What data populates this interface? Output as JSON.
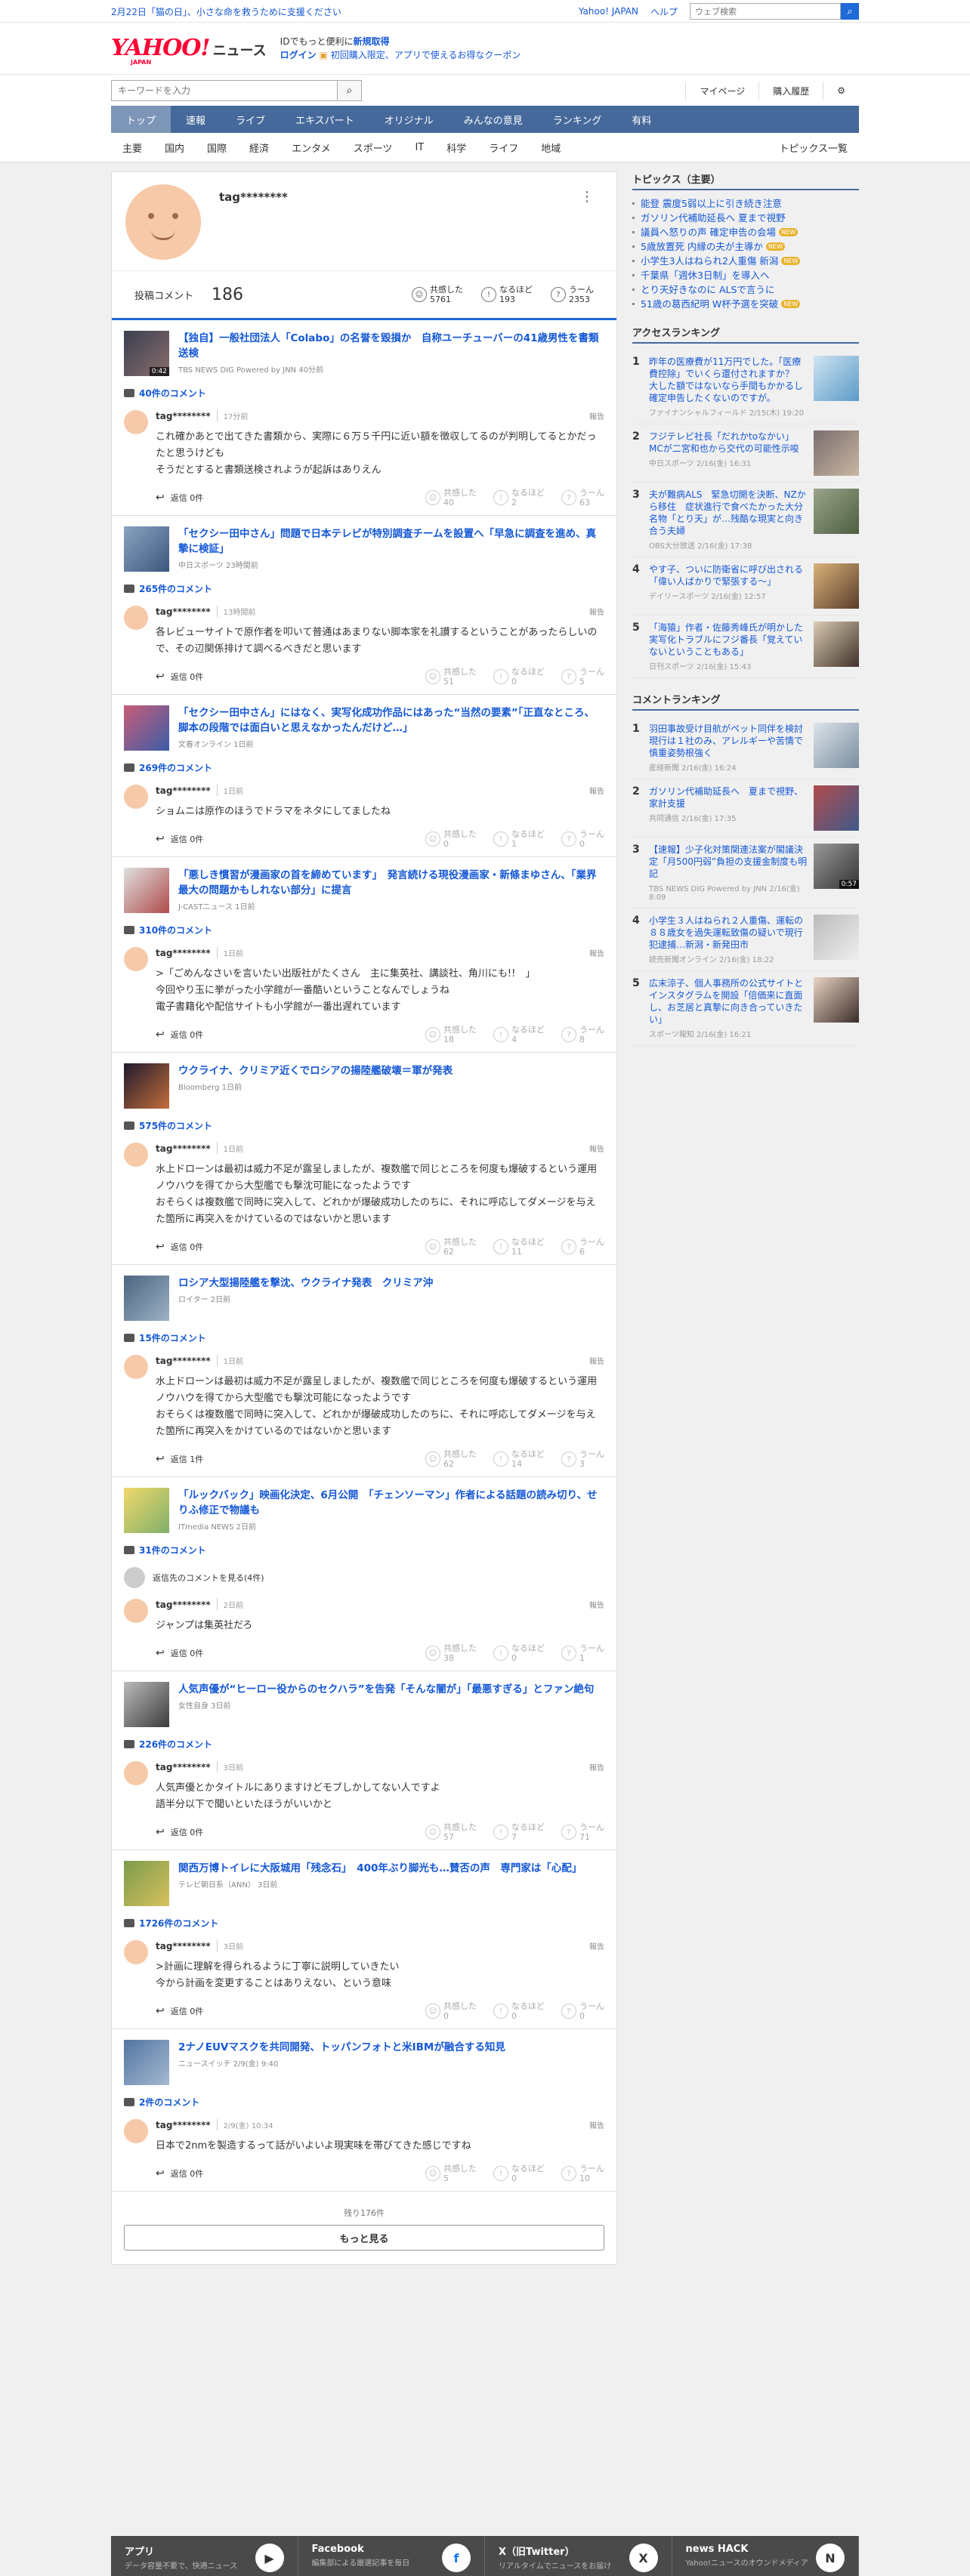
{
  "topbar": {
    "date_text": "2月22日「猫の日」、小さな命を救うために支援ください",
    "yahoo_japan": "Yahoo! JAPAN",
    "help": "ヘルプ",
    "web_search_placeholder": "ウェブ検索"
  },
  "header": {
    "logo": "YAHOO!",
    "logo_sub": "JAPAN",
    "news": "ニュース",
    "promo_line1_pre": "IDでもっと便利に",
    "promo_line1_link": "新規取得",
    "promo_line2_login": "ログイン",
    "promo_line2_text": "初回購入限定、アプリで使えるお得なクーポン"
  },
  "search": {
    "placeholder": "キーワードを入力",
    "mypage": "マイページ",
    "history": "購入履歴"
  },
  "nav": [
    "トップ",
    "速報",
    "ライブ",
    "エキスパート",
    "オリジナル",
    "みんなの意見",
    "ランキング",
    "有料"
  ],
  "subnav": [
    "主要",
    "国内",
    "国際",
    "経済",
    "エンタメ",
    "スポーツ",
    "IT",
    "科学",
    "ライフ",
    "地域"
  ],
  "subnav_all": "トピックス一覧",
  "profile": {
    "username": "tag********",
    "posts_label": "投稿コメント",
    "posts_count": "186",
    "empathy_label": "共感した",
    "empathy_count": "5761",
    "nruhodo_label": "なるほど",
    "nruhodo_count": "193",
    "uun_label": "うーん",
    "uun_count": "2353"
  },
  "articles": [
    {
      "title": "【独自】一般社団法人「Colabo」の名誉を毀損か　自称ユーチューバーの41歳男性を書類送検",
      "src": "TBS NEWS DIG Powered by JNN 40分前",
      "dur": "0:42",
      "ccount": "40件のコメント",
      "comments": [
        {
          "user": "tag********",
          "time": "17分前",
          "text": "これ確かあとで出てきた書類から、実際に６万５千円に近い額を徴収してるのが判明してるとかだったと思うけども\nそうだとすると書類送検されようが起訴はありえん",
          "reply": "返信 0件",
          "e": "40",
          "n": "2",
          "u": "63"
        }
      ]
    },
    {
      "title": "「セクシー田中さん」問題で日本テレビが特別調査チームを設置へ「早急に調査を進め、真摯に検証」",
      "src": "中日スポーツ 23時間前",
      "ccount": "265件のコメント",
      "comments": [
        {
          "user": "tag********",
          "time": "13時間前",
          "text": "各レビューサイトで原作者を叩いて普通はあまりない脚本家を礼讃するということがあったらしいので、その辺関係排けて調べるべきだと思います",
          "reply": "返信 0件",
          "e": "51",
          "n": "0",
          "u": "5"
        }
      ]
    },
    {
      "title": "「セクシー田中さん」にはなく、実写化成功作品にはあった“当然の要素”「正直なところ、脚本の段階では面白いと思えなかったんだけど…」",
      "src": "文春オンライン 1日前",
      "ccount": "269件のコメント",
      "comments": [
        {
          "user": "tag********",
          "time": "1日前",
          "text": "ショムニは原作のほうでドラマをネタにしてましたね",
          "reply": "返信 0件",
          "e": "0",
          "n": "1",
          "u": "0"
        }
      ]
    },
    {
      "title": "「悪しき慣習が漫画家の首を締めています」　発言続ける現役漫画家・新條まゆさん、「業界最大の問題かもしれない部分」に提言",
      "src": "J-CASTニュース 1日前",
      "ccount": "310件のコメント",
      "comments": [
        {
          "user": "tag********",
          "time": "1日前",
          "text": ">「ごめんなさいを言いたい出版社がたくさん　主に集英社、講談社、角川にも!!　」\n今回やり玉に挙がった小学館が一番酷いということなんでしょうね\n電子書籍化や配信サイトも小学館が一番出遅れています",
          "reply": "返信 0件",
          "e": "18",
          "n": "4",
          "u": "8"
        }
      ]
    },
    {
      "title": "ウクライナ、クリミア近くでロシアの揚陸艦破壊＝軍が発表",
      "src": "Bloomberg 1日前",
      "ccount": "575件のコメント",
      "comments": [
        {
          "user": "tag********",
          "time": "1日前",
          "text": "水上ドローンは最初は威力不足が露呈しましたが、複数艦で同じところを何度も爆破するという運用ノウハウを得てから大型艦でも撃沈可能になったようです\nおそらくは複数艦で同時に突入して、どれかが爆破成功したのちに、それに呼応してダメージを与えた箇所に再突入をかけているのではないかと思います",
          "reply": "返信 0件",
          "e": "62",
          "n": "11",
          "u": "6"
        }
      ]
    },
    {
      "title": "ロシア大型揚陸艦を撃沈、ウクライナ発表　クリミア沖",
      "src": "ロイター 2日前",
      "ccount": "15件のコメント",
      "comments": [
        {
          "user": "tag********",
          "time": "1日前",
          "text": "水上ドローンは最初は威力不足が露呈しましたが、複数艦で同じところを何度も爆破するという運用ノウハウを得てから大型艦でも撃沈可能になったようです\nおそらくは複数艦で同時に突入して、どれかが爆破成功したのちに、それに呼応してダメージを与えた箇所に再突入をかけているのではないかと思います",
          "reply": "返信 1件",
          "e": "62",
          "n": "14",
          "u": "3"
        }
      ]
    },
    {
      "title": "「ルックバック」映画化決定、6月公開　「チェンソーマン」作者による話題の読み切り、せりふ修正で物議も",
      "src": "ITmedia NEWS 2日前",
      "ccount": "31件のコメント",
      "more_replies": "返信先のコメントを見る(4件)",
      "comments": [
        {
          "user": "tag********",
          "time": "2日前",
          "text": "ジャンプは集英社だろ",
          "reply": "返信 0件",
          "e": "38",
          "n": "0",
          "u": "1"
        }
      ]
    },
    {
      "title": "人気声優が“ヒーロー役からのセクハラ”を告発「そんな闇が」「最悪すぎる」とファン絶句",
      "src": "女性自身 3日前",
      "ccount": "226件のコメント",
      "comments": [
        {
          "user": "tag********",
          "time": "3日前",
          "text": "人気声優とかタイトルにありますけどモブしかしてない人ですよ\n語半分以下で聞いといたほうがいいかと",
          "reply": "返信 0件",
          "e": "57",
          "n": "7",
          "u": "71"
        }
      ]
    },
    {
      "title": "関西万博トイレに大阪城用「残念石」　400年ぶり脚光も…賛否の声　専門家は「心配」",
      "src": "テレビ朝日系（ANN） 3日前",
      "ccount": "1726件のコメント",
      "comments": [
        {
          "user": "tag********",
          "time": "3日前",
          "text": ">計画に理解を得られるように丁寧に説明していきたい\n今から計画を変更することはありえない、という意味",
          "reply": "返信 0件",
          "e": "0",
          "n": "0",
          "u": "0"
        }
      ]
    },
    {
      "title": "2ナノEUVマスクを共同開発、トッパンフォトと米IBMが融合する知見",
      "src": "ニュースイッチ 2/9(金) 9:40",
      "ccount": "2件のコメント",
      "comments": [
        {
          "user": "tag********",
          "time": "2/9(金) 10:34",
          "text": "日本で2nmを製造するって話がいよいよ現実味を帯びてきた感じですね",
          "reply": "返信 0件",
          "e": "5",
          "n": "0",
          "u": "10"
        }
      ]
    }
  ],
  "remain": "残り176件",
  "more_button": "もっと見る",
  "reaction_labels": {
    "e": "共感した",
    "n": "なるほど",
    "u": "うーん",
    "report": "報告"
  },
  "topics": {
    "title": "トピックス（主要）",
    "items": [
      {
        "t": "能登 震度5弱以上に引き続き注意",
        "b": ""
      },
      {
        "t": "ガソリン代補助延長へ 夏まで視野",
        "b": ""
      },
      {
        "t": "議員へ怒りの声 確定申告の会場",
        "b": "NEW"
      },
      {
        "t": "5歳放置死 内縁の夫が主導か",
        "b": "NEW"
      },
      {
        "t": "小学生3人はねられ2人重傷 新潟",
        "b": "NEW"
      },
      {
        "t": "千葉県「週休3日制」を導入へ",
        "b": ""
      },
      {
        "t": "とり天好きなのに ALSで言うに",
        "b": ""
      },
      {
        "t": "51歳の葛西紀明 W杯予選を突破",
        "b": "NEW"
      }
    ]
  },
  "access_ranking": {
    "title": "アクセスランキング",
    "items": [
      {
        "t": "昨年の医療費が11万円でした。「医療費控除」でいくら還付されますか？　大した額ではないなら手間もかかるし確定申告したくないのですが。",
        "s": "ファイナンシャルフィールド 2/15(木) 19:20"
      },
      {
        "t": "フジテレビ社長「だれかtoなかい」MCが二宮和也から交代の可能性示唆",
        "s": "中日スポーツ 2/16(金) 16:31"
      },
      {
        "t": "夫が難病ALS　緊急切開を決断、NZから移住　症状進行で食べたかった大分名物「とり天」が…残酷な現実と向き合う夫婦",
        "s": "OBS大分放送 2/16(金) 17:38"
      },
      {
        "t": "やす子、ついに防衛省に呼び出される「偉い人ばかりで緊張する～」",
        "s": "デイリースポーツ 2/16(金) 12:57"
      },
      {
        "t": "「海猿」作者・佐藤秀峰氏が明かした実写化トラブルにフジ番長「覚えていないということもある」",
        "s": "日刊スポーツ 2/16(金) 15:43"
      }
    ]
  },
  "comment_ranking": {
    "title": "コメントランキング",
    "items": [
      {
        "t": "羽田事故受け目航がペット同伴を検討　現行は１社のみ、アレルギーや苦情で慎重姿勢根強く",
        "s": "産経新聞 2/16(金) 16:24"
      },
      {
        "t": "ガソリン代補助延長へ　夏まで視野、家計支援",
        "s": "共同通信 2/16(金) 17:35"
      },
      {
        "t": "【速報】少子化対策関連法案が閣議決定「月500円弱”負担の支援金制度も明記",
        "s": "TBS NEWS DIG Powered by JNN 2/16(金) 8:09",
        "dur": "0:57"
      },
      {
        "t": "小学生３人はねられ２人重傷、運転の８８歳女を過失運転致傷の疑いで現行犯逮捕…新潟・新発田市",
        "s": "読売新聞オンライン 2/16(金) 18:22"
      },
      {
        "t": "広末涼子、個人事務所の公式サイトとインスタグラムを開設「倍価来に直面し、お芝居と真摯に向き合っていきたい」",
        "s": "スポーツ報知 2/16(金) 16:21"
      }
    ]
  },
  "footer": [
    {
      "t": "アプリ",
      "d": "データ容量不要で、快適ニュース"
    },
    {
      "t": "Facebook",
      "d": "編集部による厳選記事を毎日"
    },
    {
      "t": "X（旧Twitter）",
      "d": "リアルタイムでニュースをお届け"
    },
    {
      "t": "news HACK",
      "d": "Yahoo!ニュースのオウンドメディア"
    }
  ],
  "colors": {
    "accent": "#1d6ad8",
    "nav": "#46699b",
    "logo": "#ff0033"
  }
}
